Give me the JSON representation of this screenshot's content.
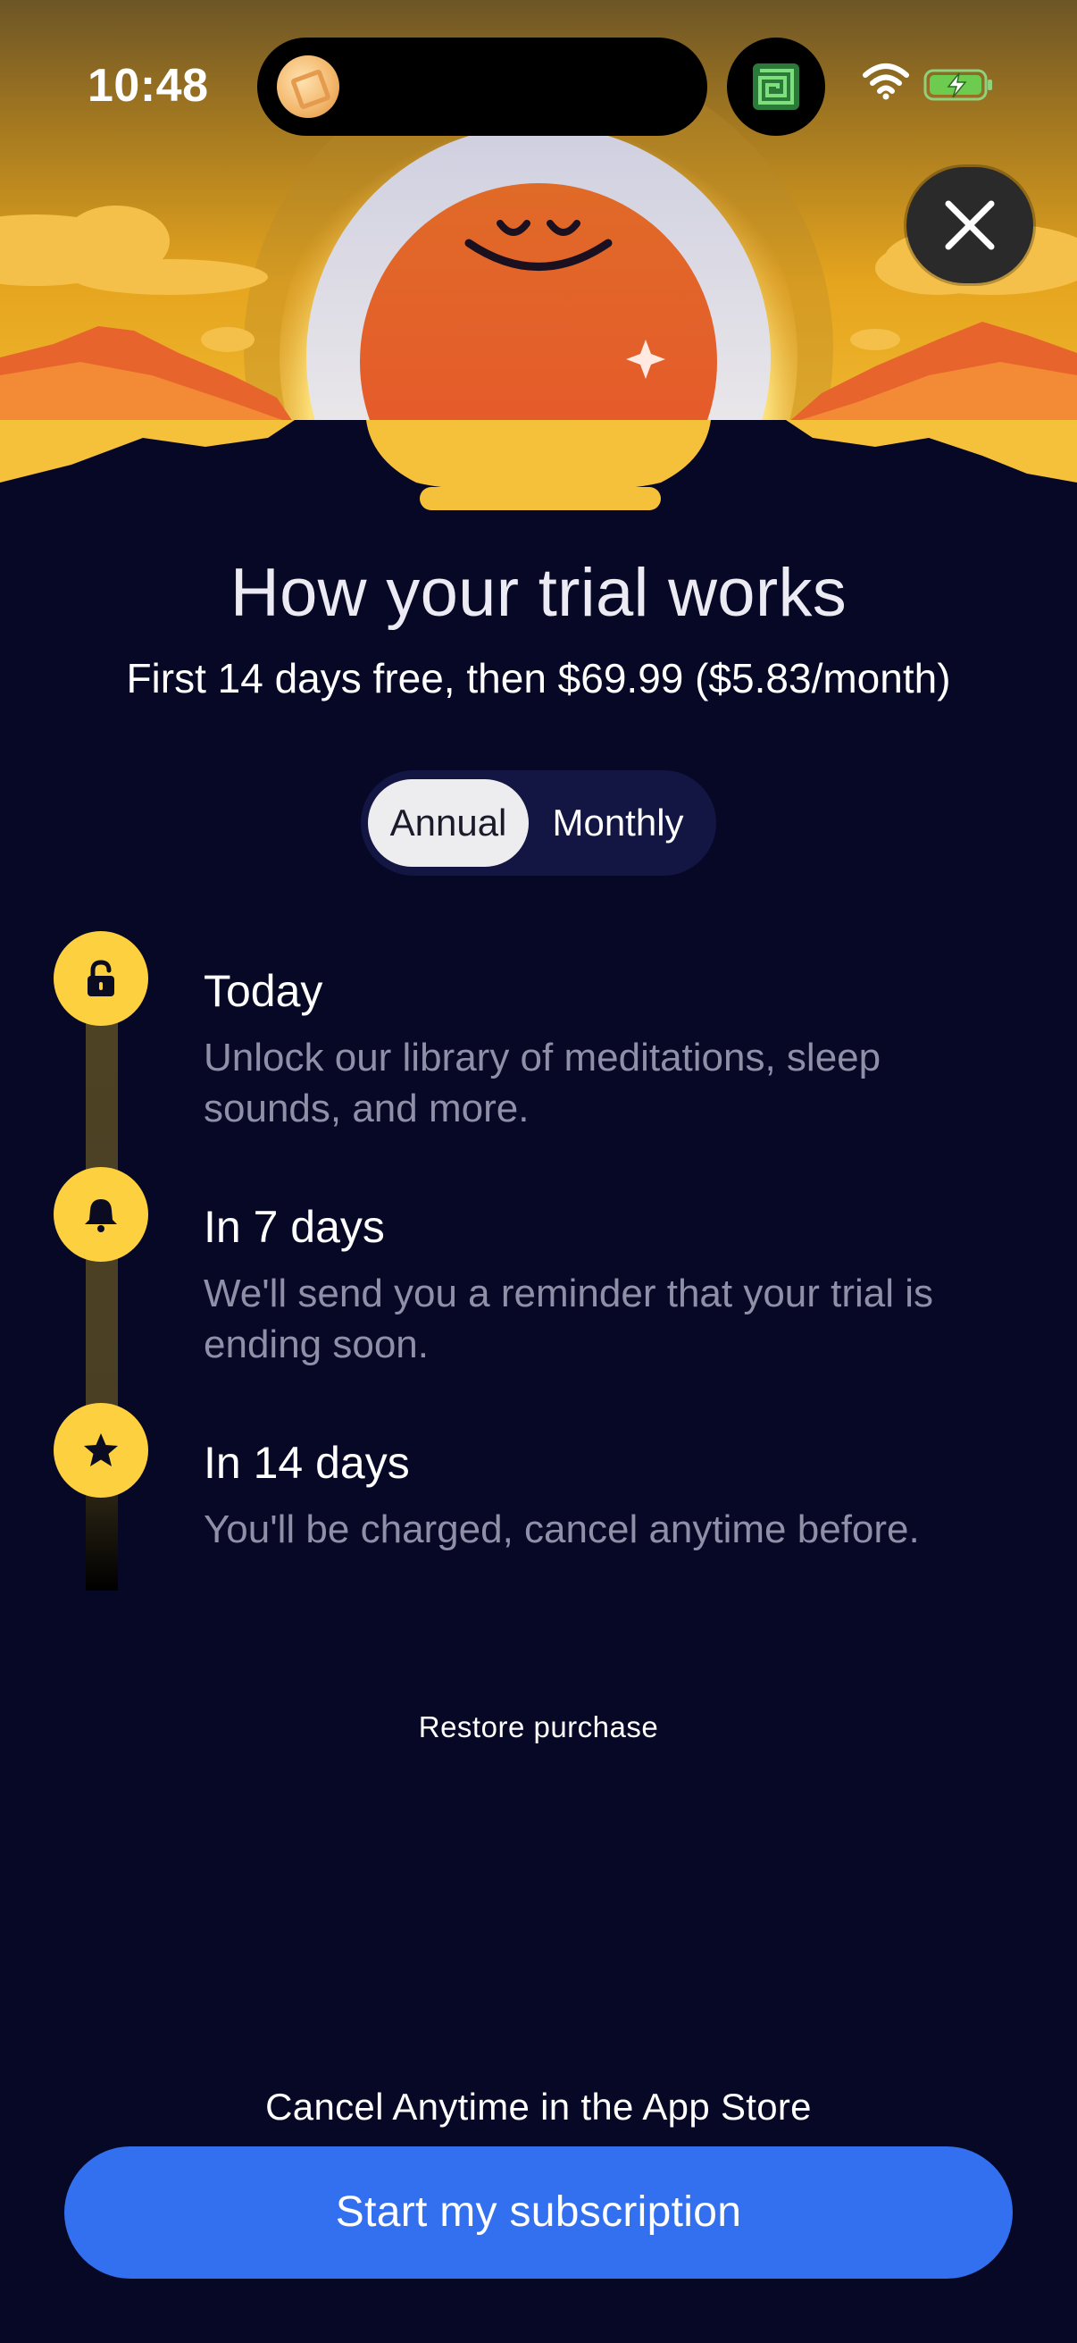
{
  "status_bar": {
    "time": "10:48"
  },
  "icons": {
    "close": "close-icon",
    "wifi": "wifi-icon",
    "battery": "battery-charging-icon",
    "step_today": "unlock-icon",
    "step_reminder": "bell-icon",
    "step_charge": "star-icon"
  },
  "colors": {
    "background": "#070826",
    "accent_yellow": "#fcd03e",
    "cta_blue": "#3370f0",
    "muted_text": "#8f8fa8"
  },
  "header": {
    "title": "How your trial works",
    "subtitle": "First 14 days free, then $69.99 ($5.83/month)"
  },
  "plan_toggle": {
    "options": [
      "Annual",
      "Monthly"
    ],
    "selected": "Annual"
  },
  "timeline": [
    {
      "title": "Today",
      "description": "Unlock our library of meditations, sleep sounds, and more."
    },
    {
      "title": "In 7 days",
      "description": "We'll send you a reminder that your trial is ending soon."
    },
    {
      "title": "In 14 days",
      "description": "You'll be charged, cancel anytime before."
    }
  ],
  "footer": {
    "restore_label": "Restore purchase",
    "cancel_note": "Cancel Anytime in the App Store",
    "cta_label": "Start my subscription"
  }
}
